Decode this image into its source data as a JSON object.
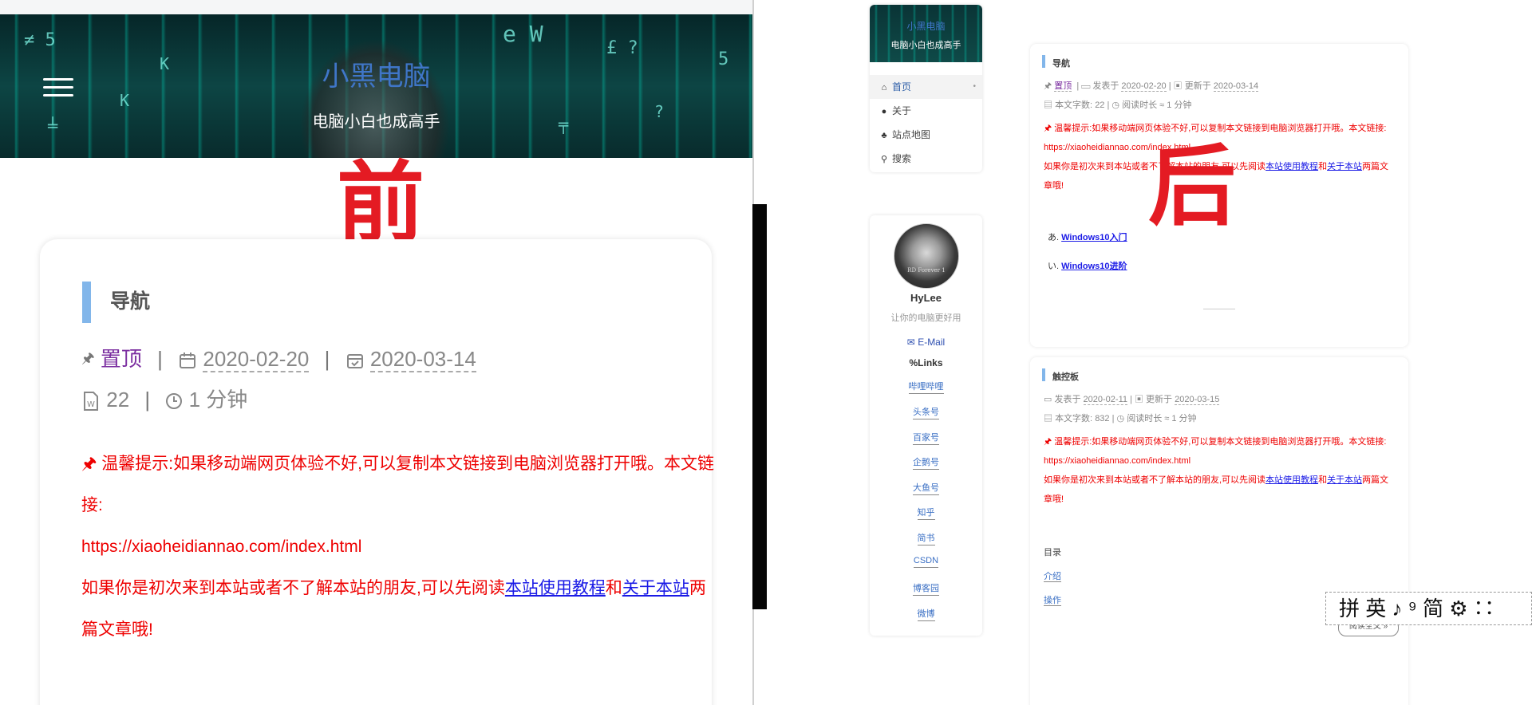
{
  "left": {
    "site_title": "小黑电脑",
    "site_subtitle": "电脑小白也成高手",
    "comparison_label": "前",
    "post": {
      "title": "导航",
      "sticky": "置顶",
      "published": "2020-02-20",
      "updated": "2020-03-14",
      "word_count": "22",
      "read_time": "1 分钟",
      "notice_prefix": "温馨提示:如果移动端网页体验不好,可以复制本文链接到电脑浏览器打开哦。本文链接:",
      "notice_url": "https://xiaoheidiannao.com/index.html",
      "notice_intro": "如果你是初次来到本站或者不了解本站的朋友,可以先阅读",
      "link_tutorial": "本站使用教程",
      "and": "和",
      "link_about": "关于本站",
      "notice_suffix": "两篇文章哦!"
    }
  },
  "right": {
    "comparison_label": "后",
    "site_title": "小黑电脑",
    "site_subtitle": "电脑小白也成高手",
    "nav": [
      {
        "label": "首页"
      },
      {
        "label": "关于"
      },
      {
        "label": "站点地图"
      },
      {
        "label": "搜索"
      }
    ],
    "profile": {
      "avatar_caption": "RD Forever 1",
      "name": "HyLee",
      "motto": "让你的电脑更好用",
      "email": "E-Mail",
      "links_heading": "Links",
      "links": [
        "哔哩哔哩",
        "头条号",
        "百家号",
        "企鹅号",
        "大鱼号",
        "知乎",
        "简书",
        "CSDN",
        "博客园",
        "微博"
      ]
    },
    "posts": [
      {
        "title": "导航",
        "sticky": "置顶",
        "published_label": "发表于",
        "published": "2020-02-20",
        "updated_label": "更新于",
        "updated": "2020-03-14",
        "words_label": "本文字数:",
        "words": "22",
        "read_label": "阅读时长 ≈",
        "read_time": "1 分钟",
        "notice_prefix": "温馨提示:如果移动端网页体验不好,可以复制本文链接到电脑浏览器打开哦。本文链接:",
        "notice_url": "https://xiaoheidiannao.com/index.html",
        "notice_intro": "如果你是初次来到本站或者不了解本站的朋友,可以先阅读",
        "link_tutorial": "本站使用教程",
        "and": "和",
        "link_about": "关于本站",
        "notice_suffix": "两篇文章哦!",
        "list": [
          {
            "marker": "あ.",
            "label": "Windows10入门"
          },
          {
            "marker": "い.",
            "label": "Windows10进阶"
          }
        ]
      },
      {
        "title": "触控板",
        "published_label": "发表于",
        "published": "2020-02-11",
        "updated_label": "更新于",
        "updated": "2020-03-15",
        "words_label": "本文字数:",
        "words": "832",
        "read_label": "阅读时长 ≈",
        "read_time": "1 分钟",
        "notice_prefix": "温馨提示:如果移动端网页体验不好,可以复制本文链接到电脑浏览器打开哦。本文链接:",
        "notice_url": "https://xiaoheidiannao.com/index.html",
        "notice_intro": "如果你是初次来到本站或者不了解本站的朋友,可以先阅读",
        "link_tutorial": "本站使用教程",
        "and": "和",
        "link_about": "关于本站",
        "notice_suffix": "两篇文章哦!",
        "toc_heading": "目录",
        "toc": [
          "介绍",
          "操作"
        ],
        "read_more": "阅读全文 »"
      }
    ],
    "ime_bar": "拼 英 ♪ ⁹ 简 ⚙ ∷"
  }
}
